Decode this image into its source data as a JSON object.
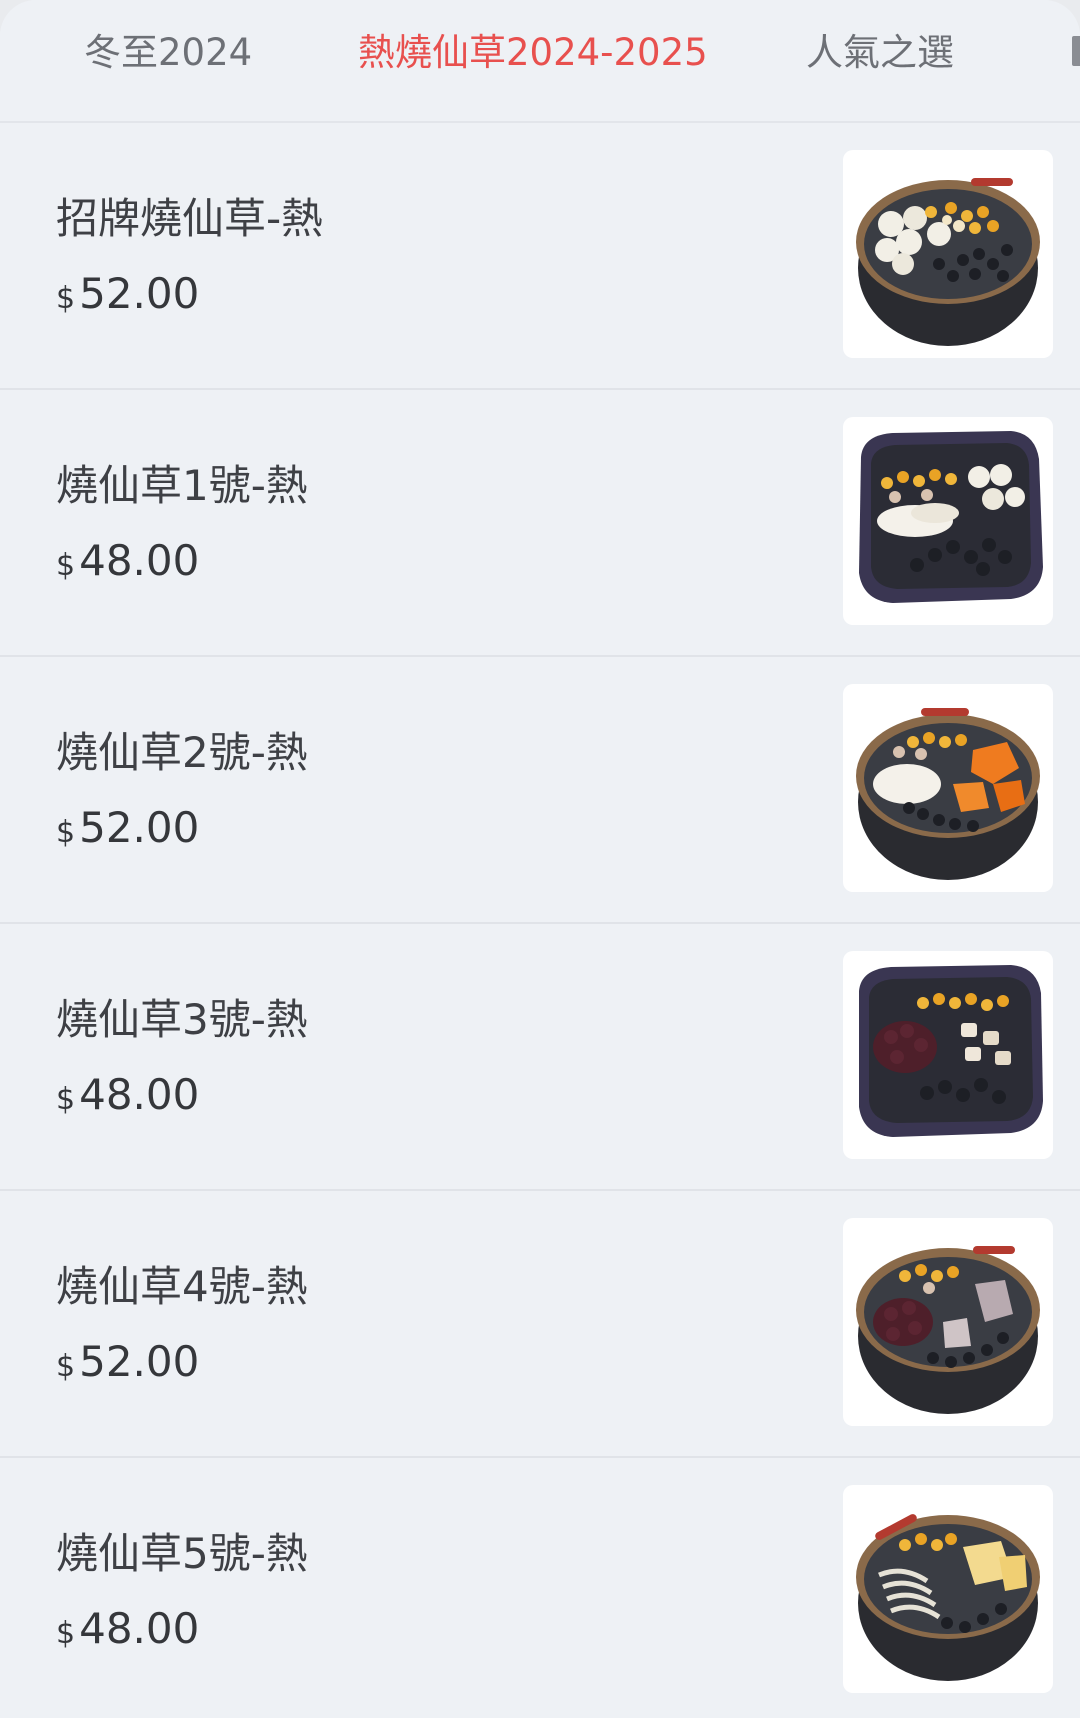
{
  "tabs": [
    {
      "label": "冬至2024",
      "active": false
    },
    {
      "label": "熱燒仙草2024-2025",
      "active": true
    },
    {
      "label": "人氣之選",
      "active": false
    }
  ],
  "colors": {
    "active_tab": "#e8504e",
    "inactive_tab": "#6d7076",
    "background": "#eef1f5"
  },
  "items": [
    {
      "name": "招牌燒仙草-熱",
      "currency": "$",
      "price": "52.00",
      "image": "round-bowl-taro-balls-peanuts-grass-jelly"
    },
    {
      "name": "燒仙草1號-熱",
      "currency": "$",
      "price": "48.00",
      "image": "square-bowl-taro-balls-barley-red-beans"
    },
    {
      "name": "燒仙草2號-熱",
      "currency": "$",
      "price": "52.00",
      "image": "round-bowl-sweet-potato-barley"
    },
    {
      "name": "燒仙草3號-熱",
      "currency": "$",
      "price": "48.00",
      "image": "square-bowl-red-beans-taro"
    },
    {
      "name": "燒仙草4號-熱",
      "currency": "$",
      "price": "52.00",
      "image": "round-bowl-red-beans-taro-chunks"
    },
    {
      "name": "燒仙草5號-熱",
      "currency": "$",
      "price": "48.00",
      "image": "round-bowl-sweet-potato-noodles"
    }
  ]
}
